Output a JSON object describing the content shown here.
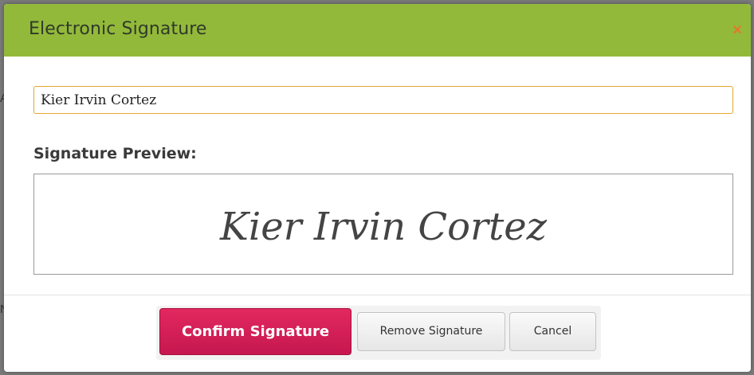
{
  "dialog": {
    "title": "Electronic Signature",
    "close_icon": "close-icon",
    "name_value": "Kier Irvin Cortez",
    "preview_label": "Signature Preview:",
    "signature_text": "Kier Irvin Cortez",
    "buttons": {
      "confirm": "Confirm Signature",
      "remove": "Remove Signature",
      "cancel": "Cancel"
    }
  },
  "colors": {
    "header": "#93b93a",
    "confirm": "#d51f56",
    "input_border": "#e3a733",
    "close": "#e07a2a"
  }
}
